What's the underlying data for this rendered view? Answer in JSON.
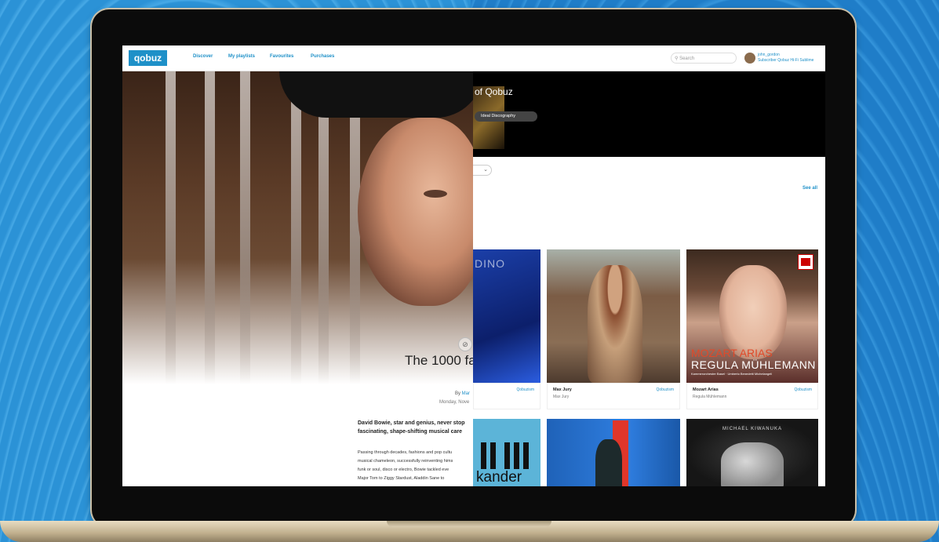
{
  "nav": {
    "logo": "qobuz",
    "links": [
      "Discover",
      "My playlists",
      "Favourites",
      "Purchases"
    ],
    "search_placeholder": "Search",
    "user_name": "john_gordon",
    "user_subscription": "Subscriber Qobuz Hi-Fi Sublime"
  },
  "article": {
    "headline": "The 1000 fa",
    "byline_prefix": "By ",
    "author": "Mar",
    "date": "Monday, Nove",
    "lead_lines": [
      "David Bowie, star and genius, never stop",
      "fascinating, shape-shifting musical care"
    ],
    "body_lines": [
      "Passing through decades, fashions and pop cultu",
      "musical chameleon, successfully reinventing hims",
      "funk or soul, disco or electro, Bowie tackled eve",
      "Major Tom to Ziggy Stardust, Aladdin Sane to"
    ]
  },
  "catalog": {
    "banner_title": "of Qobuz",
    "banner_chip": "Ideal Discography",
    "see_all": "See all",
    "cards": [
      {
        "title": "",
        "artist": "",
        "tag": "Qobuzism",
        "cover_text": "DINO"
      },
      {
        "title": "Max Jury",
        "artist": "Max Jury",
        "tag": "Qobuzism"
      },
      {
        "title": "Mozart Arias",
        "artist": "Regula Mühlemann",
        "tag": "Qobuzism",
        "cover_line1": "MOZART ARIAS",
        "cover_line2": "REGULA MÜHLEMANN",
        "cover_line3": "Kammerorchester Basel · Umberto Benedetti Michelangeli"
      },
      {
        "cover_text": "kander"
      },
      {},
      {
        "cover_text": "MICHAEL KIWANUKA"
      }
    ]
  }
}
